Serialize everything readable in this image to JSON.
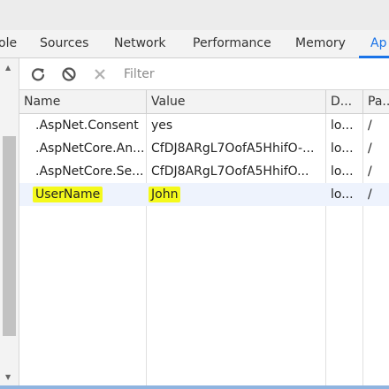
{
  "tabs": [
    {
      "label": "ole",
      "active": false
    },
    {
      "label": "Sources",
      "active": false
    },
    {
      "label": "Network",
      "active": false
    },
    {
      "label": "Performance",
      "active": false
    },
    {
      "label": "Memory",
      "active": false
    },
    {
      "label": "Ap",
      "active": true
    }
  ],
  "toolbar": {
    "filter_placeholder": "Filter",
    "icons": [
      "refresh-icon",
      "clear-all-icon",
      "delete-selected-icon"
    ]
  },
  "table": {
    "columns": [
      "Name",
      "Value",
      "D...",
      "Pa..."
    ],
    "rows": [
      {
        "name": ".AspNet.Consent",
        "value": "yes",
        "domain": "lo...",
        "path": "/"
      },
      {
        "name": ".AspNetCore.An...",
        "value": "CfDJ8ARgL7OofA5HhifO-...",
        "domain": "lo...",
        "path": "/"
      },
      {
        "name": ".AspNetCore.Se...",
        "value": "CfDJ8ARgL7OofA5HhifO...",
        "domain": "lo...",
        "path": "/"
      },
      {
        "name": "UserName",
        "value": "John",
        "domain": "lo...",
        "path": "/",
        "selected": true,
        "highlighted": true
      }
    ]
  },
  "colors": {
    "accent": "#1a73e8",
    "highlight": "#f4f91c",
    "selected_row": "#eef3fd"
  }
}
